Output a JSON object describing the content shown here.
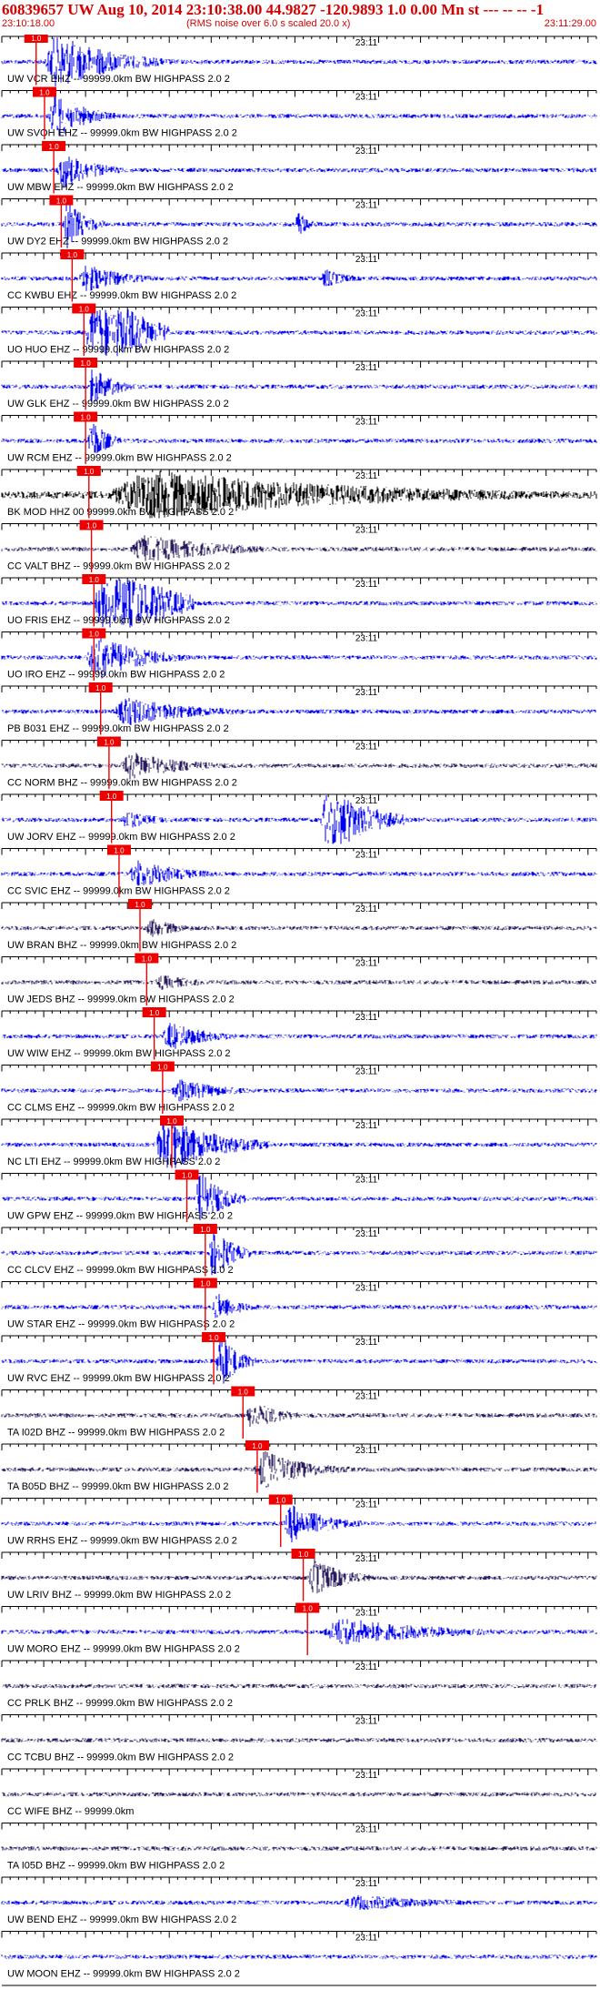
{
  "header": {
    "title": "60839657 UW Aug 10, 2014 23:10:38.00   44.9827 -120.9893  1.0 0.00 Mn st --- -- -- -1",
    "start_time": "23:10:18.00",
    "note": "(RMS noise over 6.0 s scaled 20.0 x)",
    "end_time": "23:11:29.00"
  },
  "colors": {
    "trace_blue": "#0000ee",
    "trace_dark": "#2a1a5e",
    "trace_black": "#000000",
    "pick_red": "#ee0000",
    "header_red": "#d40000",
    "axis": "#000000"
  },
  "chart_data": {
    "type": "line",
    "time_start": "23:10:18.00",
    "time_end": "23:11:29.00",
    "time_range_s": [
      0,
      71
    ],
    "minute_mark_label": "23:11",
    "minute_mark_time_s": 42,
    "pick_label": "1.0",
    "traces": [
      {
        "label": "UW VCR EHZ -- 99999.0km BW  HIGHPASS  2.0  2",
        "pick_s": 4.1,
        "color": "blue",
        "events": [
          [
            5,
            3.0,
            14
          ],
          [
            10,
            1.5,
            12
          ]
        ]
      },
      {
        "label": "UW SVOH EHZ -- 99999.0km BW  HIGHPASS  2.0  2",
        "pick_s": 5.1,
        "color": "blue",
        "events": [
          [
            5.5,
            2.5,
            8
          ]
        ]
      },
      {
        "label": "UW MBW EHZ -- 99999.0km BW  HIGHPASS  2.0  2",
        "pick_s": 6.2,
        "color": "blue",
        "events": [
          [
            6.5,
            2.0,
            8
          ]
        ]
      },
      {
        "label": "UW DY2 EHZ -- 99999.0km BW  HIGHPASS  2.0  2",
        "pick_s": 7.1,
        "color": "blue",
        "events": [
          [
            7.3,
            2.5,
            5
          ],
          [
            35,
            1.5,
            3
          ]
        ]
      },
      {
        "label": "CC KWBU EHZ -- 99999.0km BW  HIGHPASS  2.0  2",
        "pick_s": 8.4,
        "color": "blue",
        "events": [
          [
            9,
            1.5,
            10
          ],
          [
            38,
            1.0,
            6
          ]
        ]
      },
      {
        "label": "UO HUO EHZ -- 99999.0km BW  HIGHPASS  2.0  2",
        "pick_s": 9.8,
        "color": "blue",
        "events": [
          [
            10,
            6.0,
            10
          ]
        ]
      },
      {
        "label": "UW GLK EHZ -- 99999.0km BW  HIGHPASS  2.0  2",
        "pick_s": 10.0,
        "color": "blue",
        "events": [
          [
            10.2,
            2.0,
            6
          ]
        ]
      },
      {
        "label": "UW RCM EHZ -- 99999.0km BW  HIGHPASS  2.0  2",
        "pick_s": 10.0,
        "color": "blue",
        "events": [
          [
            10.2,
            2.5,
            4
          ]
        ]
      },
      {
        "label": "BK MOD HHZ 00 99999.0km BW  HIGHPASS  2.0  2",
        "pick_s": 10.4,
        "color": "black",
        "events": [
          [
            12,
            1.5,
            55
          ]
        ]
      },
      {
        "label": "CC VALT BHZ -- 99999.0km BW  HIGHPASS  2.0  2",
        "pick_s": 10.7,
        "color": "dark",
        "events": [
          [
            15,
            1.5,
            20
          ]
        ]
      },
      {
        "label": "UO FRIS EHZ -- 99999.0km BW  HIGHPASS  2.0  2",
        "pick_s": 11.0,
        "color": "blue",
        "events": [
          [
            11,
            6.0,
            12
          ]
        ]
      },
      {
        "label": "UO IRO EHZ -- 99999.0km BW  HIGHPASS  2.0  2",
        "pick_s": 11.0,
        "color": "blue",
        "events": [
          [
            10,
            2.5,
            12
          ]
        ]
      },
      {
        "label": "PB B031 EHZ -- 99999.0km BW  HIGHPASS  2.0  2",
        "pick_s": 11.8,
        "color": "blue",
        "events": [
          [
            13,
            1.5,
            18
          ]
        ]
      },
      {
        "label": "CC NORM BHZ -- 99999.0km BW  HIGHPASS  2.0  2",
        "pick_s": 12.8,
        "color": "dark",
        "events": [
          [
            14,
            1.5,
            14
          ]
        ]
      },
      {
        "label": "UW JORV EHZ -- 99999.0km BW  HIGHPASS  2.0  2",
        "pick_s": 13.1,
        "color": "blue",
        "events": [
          [
            14,
            1.0,
            8
          ],
          [
            38,
            4.0,
            10
          ]
        ]
      },
      {
        "label": "CC SVIC EHZ -- 99999.0km BW  HIGHPASS  2.0  2",
        "pick_s": 14.0,
        "color": "blue",
        "events": [
          [
            15,
            1.5,
            12
          ]
        ]
      },
      {
        "label": "UW BRAN BHZ -- 99999.0km BW  HIGHPASS  2.0  2",
        "pick_s": 16.5,
        "color": "dark",
        "events": [
          [
            17,
            1.0,
            8
          ]
        ]
      },
      {
        "label": "UW JEDS BHZ -- 99999.0km BW  HIGHPASS  2.0  2",
        "pick_s": 17.3,
        "color": "dark",
        "events": [
          [
            18,
            0.8,
            10
          ]
        ]
      },
      {
        "label": "UW WIW EHZ -- 99999.0km BW  HIGHPASS  2.0  2",
        "pick_s": 18.2,
        "color": "blue",
        "events": [
          [
            19,
            1.5,
            10
          ]
        ]
      },
      {
        "label": "CC CLMS EHZ -- 99999.0km BW  HIGHPASS  2.0  2",
        "pick_s": 19.2,
        "color": "blue",
        "events": [
          [
            20,
            1.2,
            12
          ]
        ]
      },
      {
        "label": "NC LTI EHZ -- 99999.0km BW  HIGHPASS  2.0  2",
        "pick_s": 20.3,
        "color": "blue",
        "events": [
          [
            18,
            3.0,
            14
          ]
        ]
      },
      {
        "label": "UW GPW EHZ -- 99999.0km BW  HIGHPASS  2.0  2",
        "pick_s": 22.1,
        "color": "blue",
        "events": [
          [
            23,
            3.0,
            6
          ]
        ]
      },
      {
        "label": "CC CLCV EHZ -- 99999.0km BW  HIGHPASS  2.0  2",
        "pick_s": 24.3,
        "color": "blue",
        "events": [
          [
            24.7,
            3.0,
            5
          ]
        ]
      },
      {
        "label": "UW STAR EHZ -- 99999.0km BW  HIGHPASS  2.0  2",
        "pick_s": 24.3,
        "color": "blue",
        "events": [
          [
            25,
            1.5,
            6
          ]
        ]
      },
      {
        "label": "UW RVC EHZ -- 99999.0km BW  HIGHPASS  2.0  2",
        "pick_s": 25.3,
        "color": "blue",
        "events": [
          [
            25.5,
            3.0,
            5
          ]
        ]
      },
      {
        "label": "TA I02D BHZ -- 99999.0km BW  HIGHPASS  2.0  2",
        "pick_s": 28.8,
        "color": "dark",
        "events": [
          [
            29,
            1.5,
            8
          ]
        ]
      },
      {
        "label": "TA B05D BHZ -- 99999.0km BW  HIGHPASS  2.0  2",
        "pick_s": 30.5,
        "color": "dark",
        "events": [
          [
            30,
            2.0,
            12
          ]
        ]
      },
      {
        "label": "UW RRHS EHZ -- 99999.0km BW  HIGHPASS  2.0  2",
        "pick_s": 33.3,
        "color": "blue",
        "events": [
          [
            33.5,
            2.0,
            10
          ]
        ]
      },
      {
        "label": "UW LRIV BHZ -- 99999.0km BW  HIGHPASS  2.0  2",
        "pick_s": 36.0,
        "color": "dark",
        "events": [
          [
            36.5,
            2.0,
            8
          ]
        ]
      },
      {
        "label": "UW MORO EHZ -- 99999.0km BW  HIGHPASS  2.0  2",
        "pick_s": 36.5,
        "color": "blue",
        "events": [
          [
            38,
            1.5,
            24
          ]
        ]
      },
      {
        "label": "CC PRLK BHZ -- 99999.0km BW  HIGHPASS  2.0  2",
        "pick_s": null,
        "color": "dark",
        "events": []
      },
      {
        "label": "CC TCBU BHZ -- 99999.0km BW  HIGHPASS  2.0  2",
        "pick_s": null,
        "color": "dark",
        "events": []
      },
      {
        "label": "CC WIFE BHZ -- 99999.0km",
        "pick_s": null,
        "color": "dark",
        "events": []
      },
      {
        "label": "TA I05D BHZ -- 99999.0km BW  HIGHPASS  2.0  2",
        "pick_s": null,
        "color": "dark",
        "events": []
      },
      {
        "label": "UW BEND EHZ -- 99999.0km BW  HIGHPASS  2.0  2",
        "pick_s": null,
        "color": "blue",
        "events": [
          [
            40,
            0.8,
            25
          ]
        ]
      },
      {
        "label": "UW MOON EHZ -- 99999.0km BW  HIGHPASS  2.0  2",
        "pick_s": null,
        "color": "blue",
        "events": []
      }
    ]
  }
}
